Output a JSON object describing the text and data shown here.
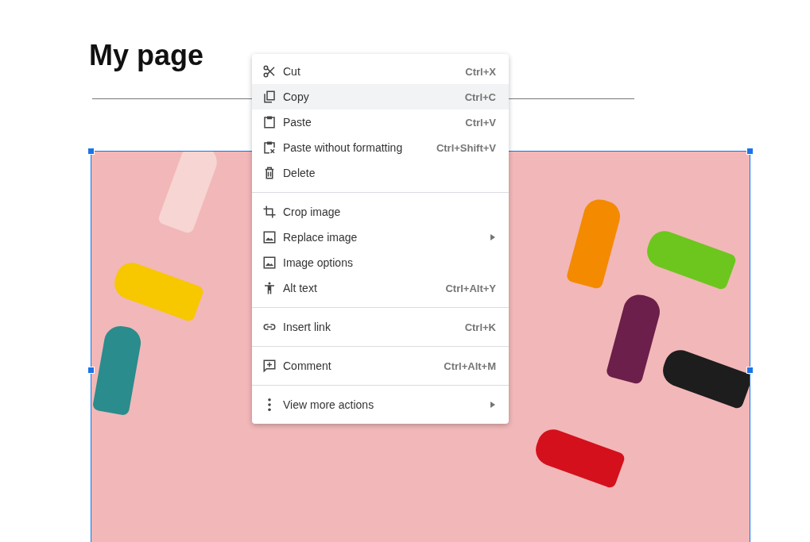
{
  "page": {
    "title": "My page"
  },
  "image": {
    "selected": true
  },
  "context_menu": {
    "groups": [
      {
        "items": [
          {
            "label": "Cut",
            "shortcut": "Ctrl+X",
            "selected": false
          },
          {
            "label": "Copy",
            "shortcut": "Ctrl+C",
            "selected": true
          },
          {
            "label": "Paste",
            "shortcut": "Ctrl+V",
            "selected": false
          },
          {
            "label": "Paste without formatting",
            "shortcut": "Ctrl+Shift+V",
            "selected": false
          },
          {
            "label": "Delete",
            "selected": false
          }
        ]
      },
      {
        "items": [
          {
            "label": "Crop image",
            "selected": false
          },
          {
            "label": "Replace image",
            "submenu": true,
            "selected": false
          },
          {
            "label": "Image options",
            "selected": false
          },
          {
            "label": "Alt text",
            "shortcut": "Ctrl+Alt+Y",
            "selected": false
          }
        ]
      },
      {
        "items": [
          {
            "label": "Insert link",
            "shortcut": "Ctrl+K",
            "selected": false
          }
        ]
      },
      {
        "items": [
          {
            "label": "Comment",
            "shortcut": "Ctrl+Alt+M",
            "selected": false
          }
        ]
      },
      {
        "items": [
          {
            "label": "View more actions",
            "submenu": true,
            "selected": false
          }
        ]
      }
    ]
  }
}
